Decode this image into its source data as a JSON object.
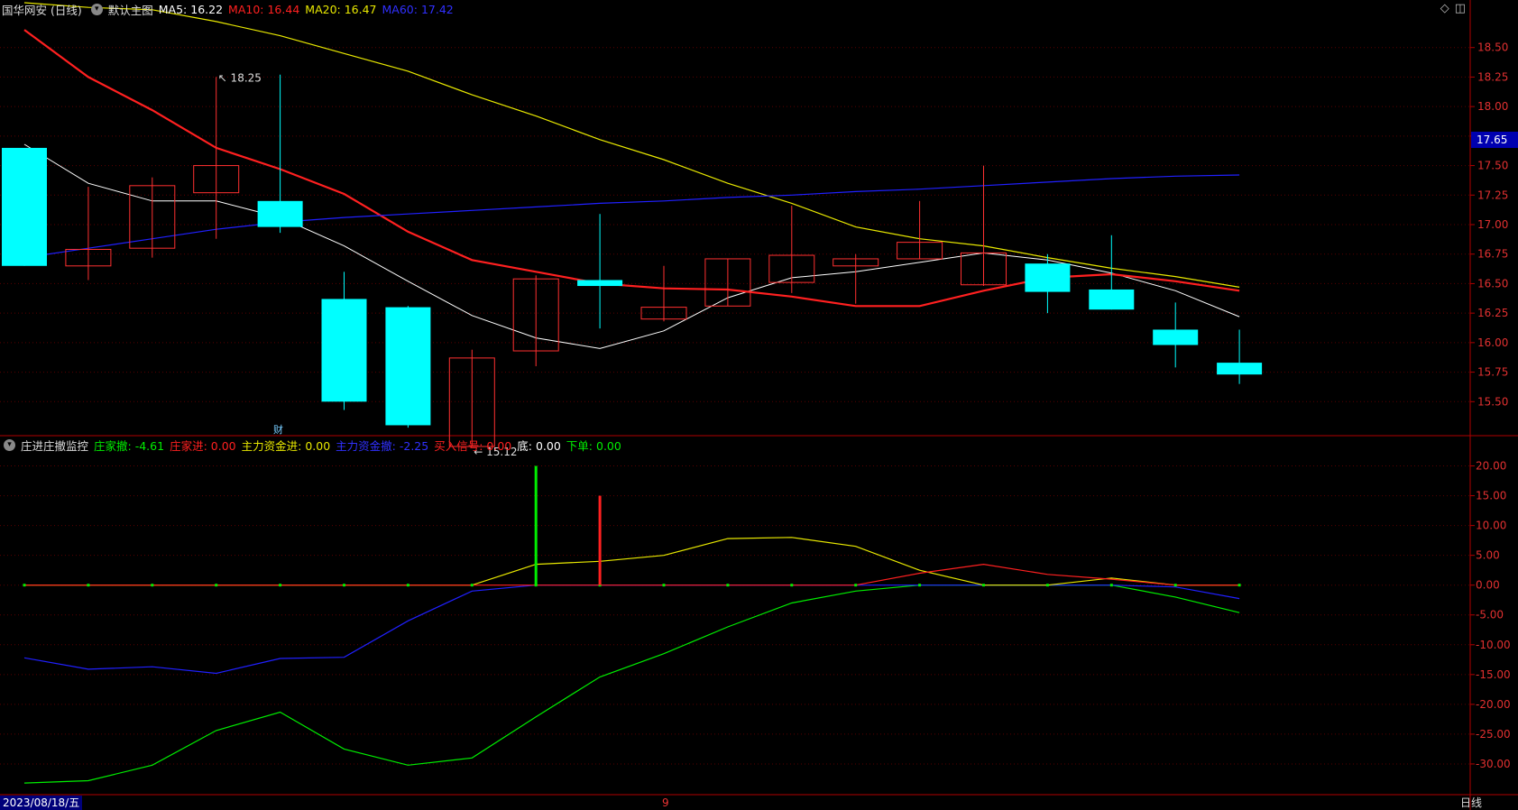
{
  "main_header": {
    "stock": "国华网安 (日线)",
    "template": "默认主图",
    "ma5": {
      "label": "MA5:",
      "value": "16.22",
      "color": "#ffffff"
    },
    "ma10": {
      "label": "MA10:",
      "value": "16.44",
      "color": "#ff2020"
    },
    "ma20": {
      "label": "MA20:",
      "value": "16.47",
      "color": "#e8e800"
    },
    "ma60": {
      "label": "MA60:",
      "value": "17.42",
      "color": "#2020ff"
    }
  },
  "sub_header": {
    "indicator": "庄进庄撤监控",
    "items": [
      {
        "label": "庄家撤:",
        "value": "-4.61",
        "color": "#00ee00"
      },
      {
        "label": "庄家进:",
        "value": "0.00",
        "color": "#ff2020"
      },
      {
        "label": "主力资金进:",
        "value": "0.00",
        "color": "#e8e800"
      },
      {
        "label": "主力资金撤:",
        "value": "-2.25",
        "color": "#3030ff"
      },
      {
        "label": "买入信号:",
        "value": "0.00",
        "color": "#ff2020"
      },
      {
        "label": "底:",
        "value": "0.00",
        "color": "#ffffff"
      },
      {
        "label": "下单:",
        "value": "0.00",
        "color": "#00ee00"
      }
    ]
  },
  "current_price_tag": "17.65",
  "marker_cai": "财",
  "date_label": "2023/08/18/五",
  "month_marker": "9",
  "period_tab": "日线",
  "icons": [
    "diamond-icon",
    "window-icon"
  ],
  "chart_data": [
    {
      "type": "candlestick",
      "ylim": [
        15.25,
        18.75
      ],
      "yticks": [
        "18.50",
        "18.25",
        "18.00",
        "17.75",
        "17.50",
        "17.25",
        "17.00",
        "16.75",
        "16.50",
        "16.25",
        "16.00",
        "15.75",
        "15.50"
      ],
      "candles": [
        {
          "o": 17.65,
          "h": 17.65,
          "l": 16.65,
          "c": 16.65
        },
        {
          "o": 16.65,
          "h": 17.32,
          "l": 16.53,
          "c": 16.79
        },
        {
          "o": 16.8,
          "h": 17.4,
          "l": 16.72,
          "c": 17.33
        },
        {
          "o": 17.27,
          "h": 18.25,
          "l": 16.88,
          "c": 17.5
        },
        {
          "o": 17.2,
          "h": 18.27,
          "l": 16.93,
          "c": 16.98
        },
        {
          "o": 16.37,
          "h": 16.6,
          "l": 15.43,
          "c": 15.5
        },
        {
          "o": 16.3,
          "h": 16.31,
          "l": 15.28,
          "c": 15.3
        },
        {
          "o": 15.12,
          "h": 15.94,
          "l": 15.12,
          "c": 15.87
        },
        {
          "o": 15.93,
          "h": 16.57,
          "l": 15.8,
          "c": 16.54
        },
        {
          "o": 16.53,
          "h": 17.09,
          "l": 16.12,
          "c": 16.48
        },
        {
          "o": 16.2,
          "h": 16.65,
          "l": 16.18,
          "c": 16.3
        },
        {
          "o": 16.31,
          "h": 16.71,
          "l": 16.31,
          "c": 16.71
        },
        {
          "o": 16.51,
          "h": 17.16,
          "l": 16.42,
          "c": 16.74
        },
        {
          "o": 16.65,
          "h": 16.75,
          "l": 16.33,
          "c": 16.71
        },
        {
          "o": 16.71,
          "h": 17.2,
          "l": 16.71,
          "c": 16.85
        },
        {
          "o": 16.49,
          "h": 17.5,
          "l": 16.48,
          "c": 16.76
        },
        {
          "o": 16.67,
          "h": 16.75,
          "l": 16.25,
          "c": 16.43
        },
        {
          "o": 16.45,
          "h": 16.91,
          "l": 16.28,
          "c": 16.28
        },
        {
          "o": 16.11,
          "h": 16.34,
          "l": 15.79,
          "c": 15.98
        },
        {
          "o": 15.83,
          "h": 16.11,
          "l": 15.65,
          "c": 15.73
        }
      ],
      "series": [
        {
          "name": "MA5",
          "values": [
            17.68,
            17.35,
            17.2,
            17.2,
            17.06,
            16.82,
            16.52,
            16.23,
            16.04,
            15.95,
            16.1,
            16.38,
            16.55,
            16.6,
            16.68,
            16.76,
            16.7,
            16.59,
            16.44,
            16.22
          ]
        },
        {
          "name": "MA10",
          "values": [
            18.65,
            18.25,
            17.97,
            17.65,
            17.47,
            17.26,
            16.94,
            16.7,
            16.6,
            16.5,
            16.46,
            16.45,
            16.39,
            16.31,
            16.31,
            16.44,
            16.55,
            16.58,
            16.52,
            16.44
          ]
        },
        {
          "name": "MA20",
          "values": [
            18.88,
            18.84,
            18.82,
            18.72,
            18.6,
            18.45,
            18.3,
            18.1,
            17.92,
            17.72,
            17.55,
            17.35,
            17.18,
            16.98,
            16.88,
            16.82,
            16.72,
            16.63,
            16.56,
            16.47
          ]
        },
        {
          "name": "MA60",
          "values": [
            16.72,
            16.8,
            16.88,
            16.96,
            17.02,
            17.06,
            17.09,
            17.12,
            17.15,
            17.18,
            17.2,
            17.23,
            17.25,
            17.28,
            17.3,
            17.33,
            17.36,
            17.39,
            17.41,
            17.42
          ]
        }
      ],
      "annotations": [
        {
          "label": "18.25",
          "value": 18.25
        },
        {
          "label": "15.12",
          "value": 15.12
        }
      ]
    },
    {
      "type": "line",
      "ylim": [
        -35,
        22.5
      ],
      "yticks": [
        "20.00",
        "15.00",
        "10.00",
        "5.00",
        "0.00",
        "-5.00",
        "-10.00",
        "-15.00",
        "-20.00",
        "-25.00",
        "-30.00"
      ],
      "series": [
        {
          "name": "庄家撤",
          "values": [
            -33.2,
            -32.8,
            -30.2,
            -24.4,
            -21.3,
            -27.5,
            -30.2,
            -29.0,
            -22.1,
            -15.4,
            -11.5,
            -7.0,
            -3.0,
            -1.0,
            0.0,
            0.0,
            0.0,
            0.0,
            -2.0,
            -4.61
          ]
        },
        {
          "name": "主力资金撤",
          "values": [
            -12.2,
            -14.1,
            -13.7,
            -14.8,
            -12.3,
            -12.1,
            -6.0,
            -1.0,
            0.0,
            0.0,
            0.0,
            0.0,
            0.0,
            0.0,
            0.0,
            0.0,
            0.0,
            0.0,
            -0.3,
            -2.25
          ]
        },
        {
          "name": "主力资金进",
          "values": [
            0,
            0,
            0,
            0,
            0,
            0,
            0,
            0,
            3.5,
            4.0,
            5.0,
            7.8,
            8.0,
            6.5,
            2.5,
            0.0,
            0.0,
            1.2,
            0.0,
            0.0
          ]
        },
        {
          "name": "庄家进",
          "values": [
            0,
            0,
            0,
            0,
            0,
            0,
            0,
            0,
            0,
            0,
            0,
            0,
            0,
            0,
            2.0,
            3.5,
            1.8,
            1.0,
            0.0,
            0.0
          ]
        }
      ],
      "bars": [
        {
          "index": 8,
          "value": 20.0,
          "color": "#00ee00"
        },
        {
          "index": 9,
          "value": 15.0,
          "color": "#ff2020"
        }
      ]
    }
  ]
}
